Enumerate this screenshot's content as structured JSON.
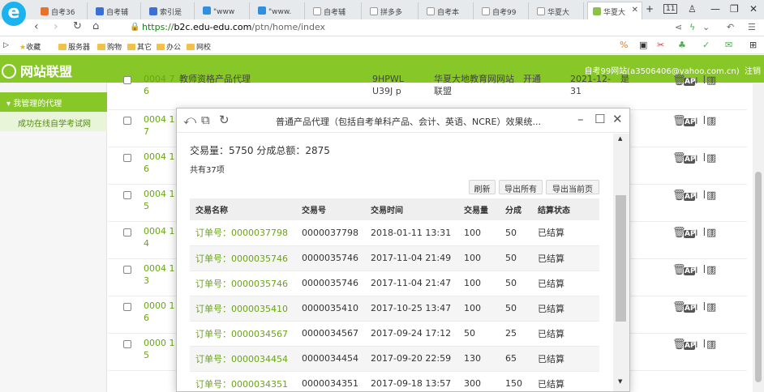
{
  "browser": {
    "tabs": [
      {
        "label": "自考36",
        "color": "#e8722b"
      },
      {
        "label": "自考辅",
        "color": "#3a6fd8"
      },
      {
        "label": "索引是",
        "color": "#3a6fd8"
      },
      {
        "label": "\"www",
        "color": "#2f8fe0"
      },
      {
        "label": "\"www.",
        "color": "#2f8fe0"
      },
      {
        "label": "自考辅",
        "color": "#ffffff"
      },
      {
        "label": "拼多多",
        "color": "#ffffff"
      },
      {
        "label": "自考本",
        "color": "#ffffff"
      },
      {
        "label": "自考99",
        "color": "#ffffff"
      },
      {
        "label": "华夏大",
        "color": "#ffffff"
      },
      {
        "label": "华夏大",
        "color": "#8bc34a"
      }
    ],
    "tab_count": "11",
    "url_scheme": "https://",
    "url_host": "b2c.edu-edu.com",
    "url_path": "/ptn/home/index",
    "bookmarks": [
      "收藏",
      "服务器",
      "购物",
      "其它",
      "办公",
      "网校"
    ]
  },
  "site": {
    "name": "网站联盟",
    "user": "自考99网站(a3506406@yahoo.com.cn)",
    "logout": "注销"
  },
  "sidebar": {
    "group": "我管理的代理",
    "item": "成功在线自学考试网"
  },
  "bg_table": {
    "rows": [
      {
        "id": "0004 76",
        "text": "教师资格产品代理",
        "code": "9HPWLU39J p",
        "org": "华夏大地教育网网站 联盟",
        "status": "开通",
        "date": "2021-12-31",
        "flag": "是"
      },
      {
        "id": "0004 17"
      },
      {
        "id": "0004 16"
      },
      {
        "id": "0004 15"
      },
      {
        "id": "0004 14"
      },
      {
        "id": "0004 13"
      },
      {
        "id": "0000 16"
      },
      {
        "id": "0000 15"
      }
    ],
    "action_labels": {
      "ap": "AP"
    }
  },
  "modal": {
    "title": "普通产品代理（包括自考单科产品、会计、英语、NCRE）效果统...",
    "summary": "交易量：5750   分成总额：2875",
    "count": "共有37项",
    "buttons": {
      "refresh": "刷新",
      "export_all": "导出所有",
      "export_page": "导出当前页"
    },
    "columns": [
      "交易名称",
      "交易号",
      "交易时间",
      "交易量",
      "分成",
      "结算状态"
    ],
    "rows": [
      {
        "name": "订单号：0000037798",
        "no": "0000037798",
        "time": "2018-01-11 13:31",
        "qty": "100",
        "share": "50",
        "status": "已结算"
      },
      {
        "name": "订单号：0000035746",
        "no": "0000035746",
        "time": "2017-11-04 21:49",
        "qty": "100",
        "share": "50",
        "status": "已结算"
      },
      {
        "name": "订单号：0000035746",
        "no": "0000035746",
        "time": "2017-11-04 21:47",
        "qty": "100",
        "share": "50",
        "status": "已结算"
      },
      {
        "name": "订单号：0000035410",
        "no": "0000035410",
        "time": "2017-10-25 13:47",
        "qty": "100",
        "share": "50",
        "status": "已结算"
      },
      {
        "name": "订单号：0000034567",
        "no": "0000034567",
        "time": "2017-09-24 17:12",
        "qty": "50",
        "share": "25",
        "status": "已结算"
      },
      {
        "name": "订单号：0000034454",
        "no": "0000034454",
        "time": "2017-09-20 22:59",
        "qty": "130",
        "share": "65",
        "status": "已结算"
      },
      {
        "name": "订单号：0000034351",
        "no": "0000034351",
        "time": "2017-09-18 13:57",
        "qty": "300",
        "share": "150",
        "status": "已结算"
      }
    ]
  }
}
